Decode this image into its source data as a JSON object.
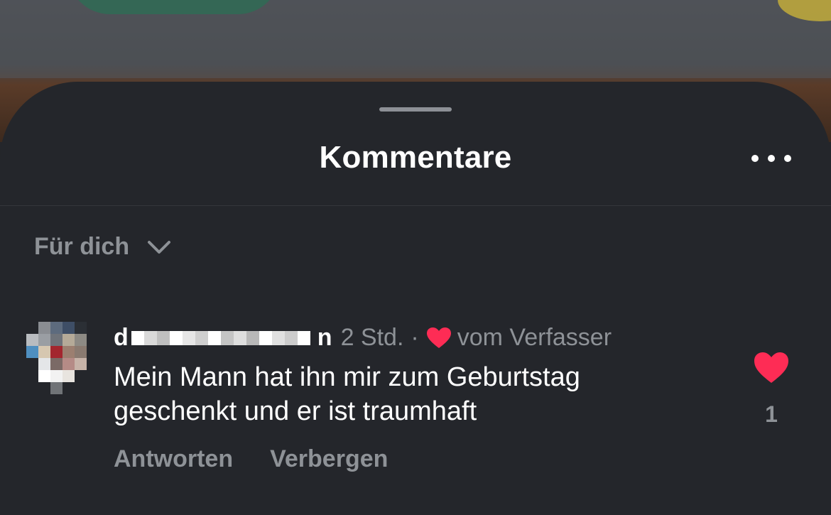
{
  "sheet": {
    "title": "Kommentare",
    "more_icon": "more-horizontal-icon"
  },
  "sort": {
    "label": "Für dich",
    "icon": "chevron-down-icon"
  },
  "comment": {
    "username_initial": "d",
    "username_end": "n",
    "timestamp": "2 Std.",
    "separator": "·",
    "creator_liked_label": "vom Verfasser",
    "text_line1": "Mein Mann hat ihn mir zum Geburtstag",
    "text_line2": "geschenkt und er ist traumhaft",
    "actions": {
      "reply": "Antworten",
      "hide": "Verbergen"
    },
    "like_count": "1",
    "liked": true
  },
  "colors": {
    "sheet_background": "#24262b",
    "text_primary": "#ffffff",
    "text_secondary": "#8e9297",
    "like_red": "#fe2c55"
  }
}
